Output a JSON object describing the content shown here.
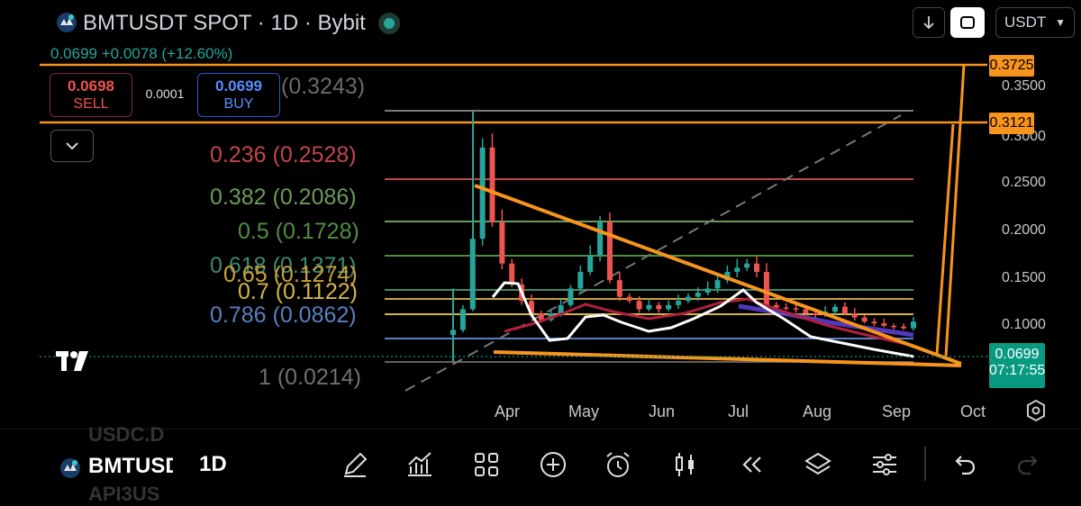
{
  "header": {
    "title": "BMTUSDT SPOT · 1D · Bybit",
    "change": "0.0699 +0.0078 (+12.60%)",
    "currency_selector": "USDT"
  },
  "order": {
    "sell_price": "0.0698",
    "sell_label": "SELL",
    "spread": "0.0001",
    "buy_price": "0.0699",
    "buy_label": "BUY"
  },
  "fib_labels": {
    "l0": "(0.3243)",
    "l236": "0.236 (0.2528)",
    "l382": "0.382 (0.2086)",
    "l5": "0.5 (0.1728)",
    "l618": "0.618 (0.1371)",
    "l65": "0.65 (0.1274)",
    "l7": "0.7 (0.1122)",
    "l786": "0.786 (0.0862)",
    "l1": "1 (0.0214)"
  },
  "price_axis": {
    "ticks": [
      "0.3500",
      "0.3000",
      "0.2500",
      "0.2000",
      "0.1500",
      "0.1000"
    ],
    "high_tag": "0.3725",
    "mid_tag": "0.3121",
    "current_price": "0.0699",
    "countdown": "07:17:55"
  },
  "time_axis": {
    "months": [
      "Apr",
      "May",
      "Jun",
      "Jul",
      "Aug",
      "Sep",
      "Oct"
    ]
  },
  "bottom": {
    "symbol": "BMTUSDT",
    "symbol_ghost_top": "USDC.D",
    "symbol_ghost_bottom": "API3US",
    "interval": "1D"
  },
  "colors": {
    "up": "#26a69a",
    "down": "#ef5350",
    "drawing": "#f7941d",
    "fib_0": "#7a7a7a",
    "fib_236": "#c0464b",
    "fib_382": "#6b9a5a",
    "fib_5": "#4f8f3f",
    "fib_618": "#3d8a6a",
    "fib_65": "#c9a23a",
    "fib_7": "#d4b548",
    "fib_786": "#5a7fc0",
    "fib_1": "#808080"
  },
  "chart_data": {
    "type": "candlestick",
    "pair": "BMTUSDT",
    "interval": "1D",
    "x_labels": [
      "Apr",
      "May",
      "Jun",
      "Jul",
      "Aug",
      "Sep",
      "Oct"
    ],
    "ylim": [
      0.02,
      0.375
    ],
    "approx_closes": [
      [
        0.06,
        0.085,
        0.17,
        0.28,
        0.19,
        0.14,
        0.115,
        0.095,
        0.08,
        0.072,
        0.08,
        0.09,
        0.11,
        0.13,
        0.15,
        0.19,
        0.12,
        0.1,
        0.095,
        0.085,
        0.09,
        0.085,
        0.09,
        0.095,
        0.1,
        0.105,
        0.11,
        0.12,
        0.13,
        0.135,
        0.14,
        0.13,
        0.09,
        0.087,
        0.086,
        0.085,
        0.08,
        0.078,
        0.082,
        0.088,
        0.08,
        0.075,
        0.07,
        0.068,
        0.065,
        0.064,
        0.062,
        0.07
      ]
    ],
    "fibonacci": [
      {
        "level": 0,
        "price": 0.3243
      },
      {
        "level": 0.236,
        "price": 0.2528
      },
      {
        "level": 0.382,
        "price": 0.2086
      },
      {
        "level": 0.5,
        "price": 0.1728
      },
      {
        "level": 0.618,
        "price": 0.1371
      },
      {
        "level": 0.65,
        "price": 0.1274
      },
      {
        "level": 0.7,
        "price": 0.1122
      },
      {
        "level": 0.786,
        "price": 0.0862
      },
      {
        "level": 1,
        "price": 0.0214
      }
    ],
    "horizontal_levels": [
      0.3725,
      0.3121
    ],
    "current_price": 0.0699,
    "grid": false
  }
}
